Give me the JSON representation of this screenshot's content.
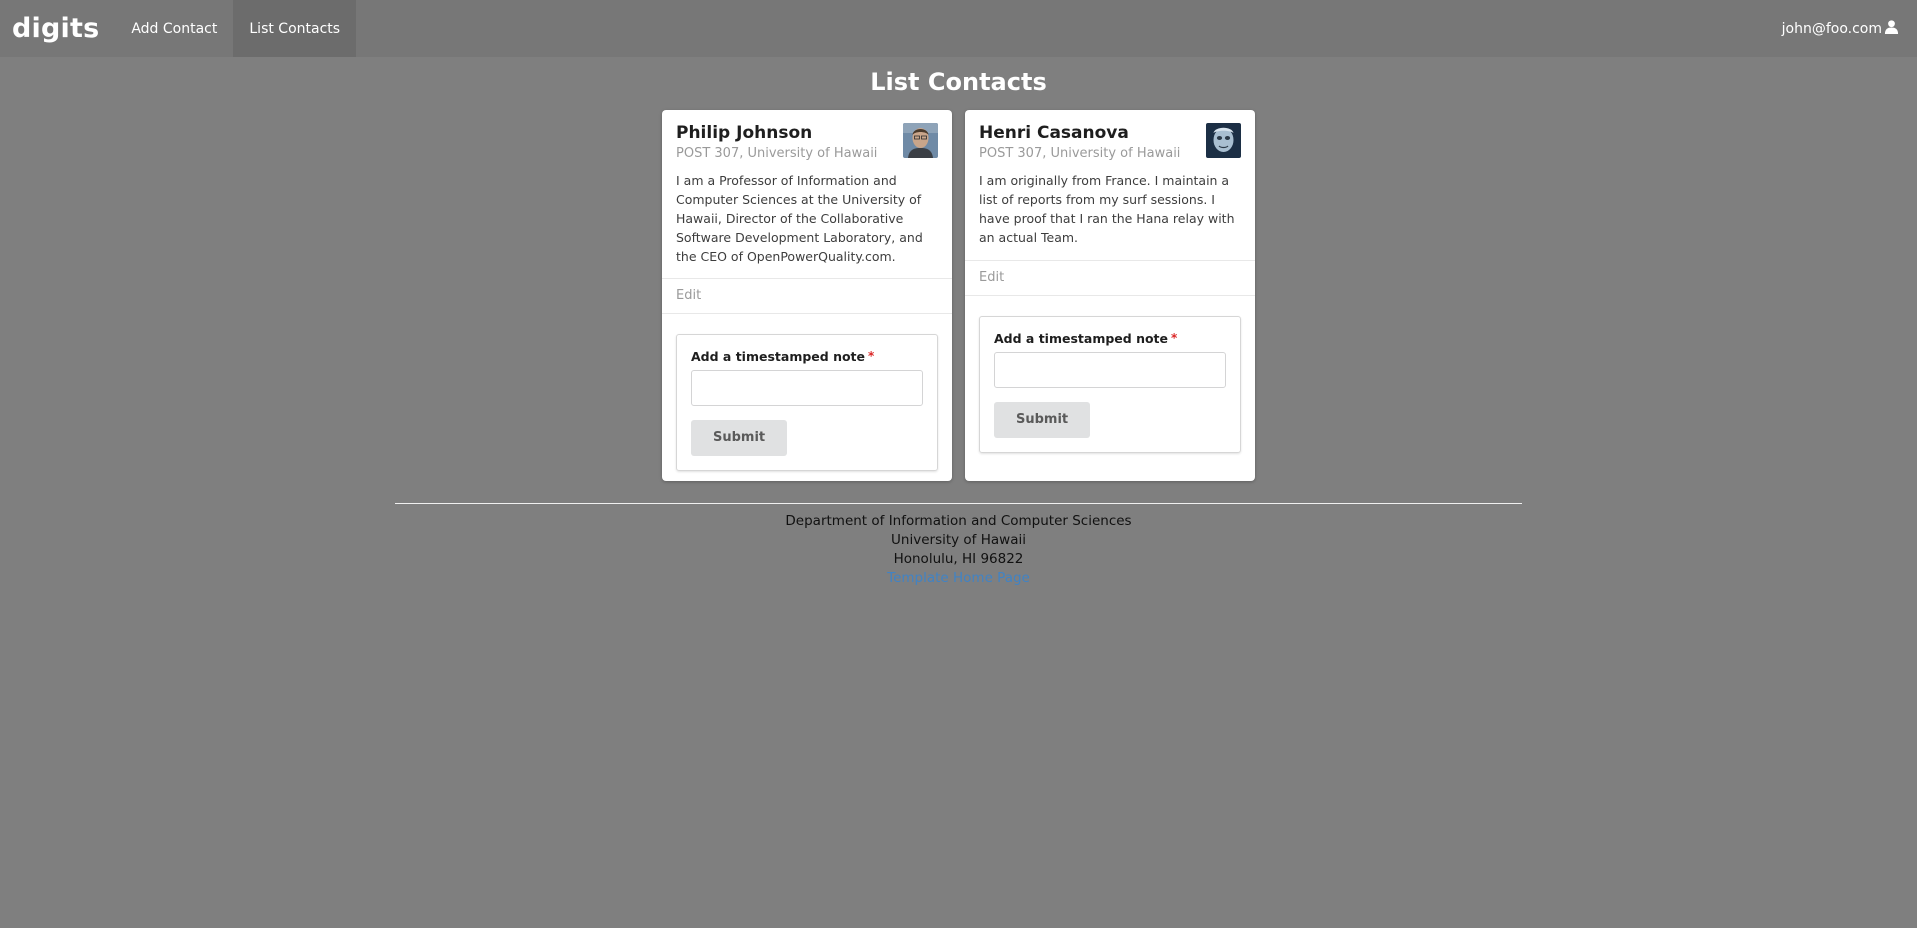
{
  "navbar": {
    "brand": "digits",
    "items": [
      {
        "label": "Add Contact",
        "active": false
      },
      {
        "label": "List Contacts",
        "active": true
      }
    ],
    "user": "john@foo.com",
    "user_icon": "user-icon"
  },
  "page": {
    "title": "List Contacts"
  },
  "contacts": [
    {
      "name": "Philip Johnson",
      "address": "POST 307, University of Hawaii",
      "description": "I am a Professor of Information and Computer Sciences at the University of Hawaii, Director of the Collaborative Software Development Laboratory, and the CEO of OpenPowerQuality.com.",
      "edit_label": "Edit",
      "note_label": "Add a timestamped note",
      "note_value": "",
      "submit_label": "Submit"
    },
    {
      "name": "Henri Casanova",
      "address": "POST 307, University of Hawaii",
      "description": "I am originally from France. I maintain a list of reports from my surf sessions. I have proof that I ran the Hana relay with an actual Team.",
      "edit_label": "Edit",
      "note_label": "Add a timestamped note",
      "note_value": "",
      "submit_label": "Submit"
    }
  ],
  "footer": {
    "line1": "Department of Information and Computer Sciences",
    "line2": "University of Hawaii",
    "line3": "Honolulu, HI 96822",
    "link": "Template Home Page"
  },
  "colors": {
    "background": "#7f7f7f",
    "navbar": "#777777",
    "link": "#4183c4",
    "required": "#db2828"
  }
}
